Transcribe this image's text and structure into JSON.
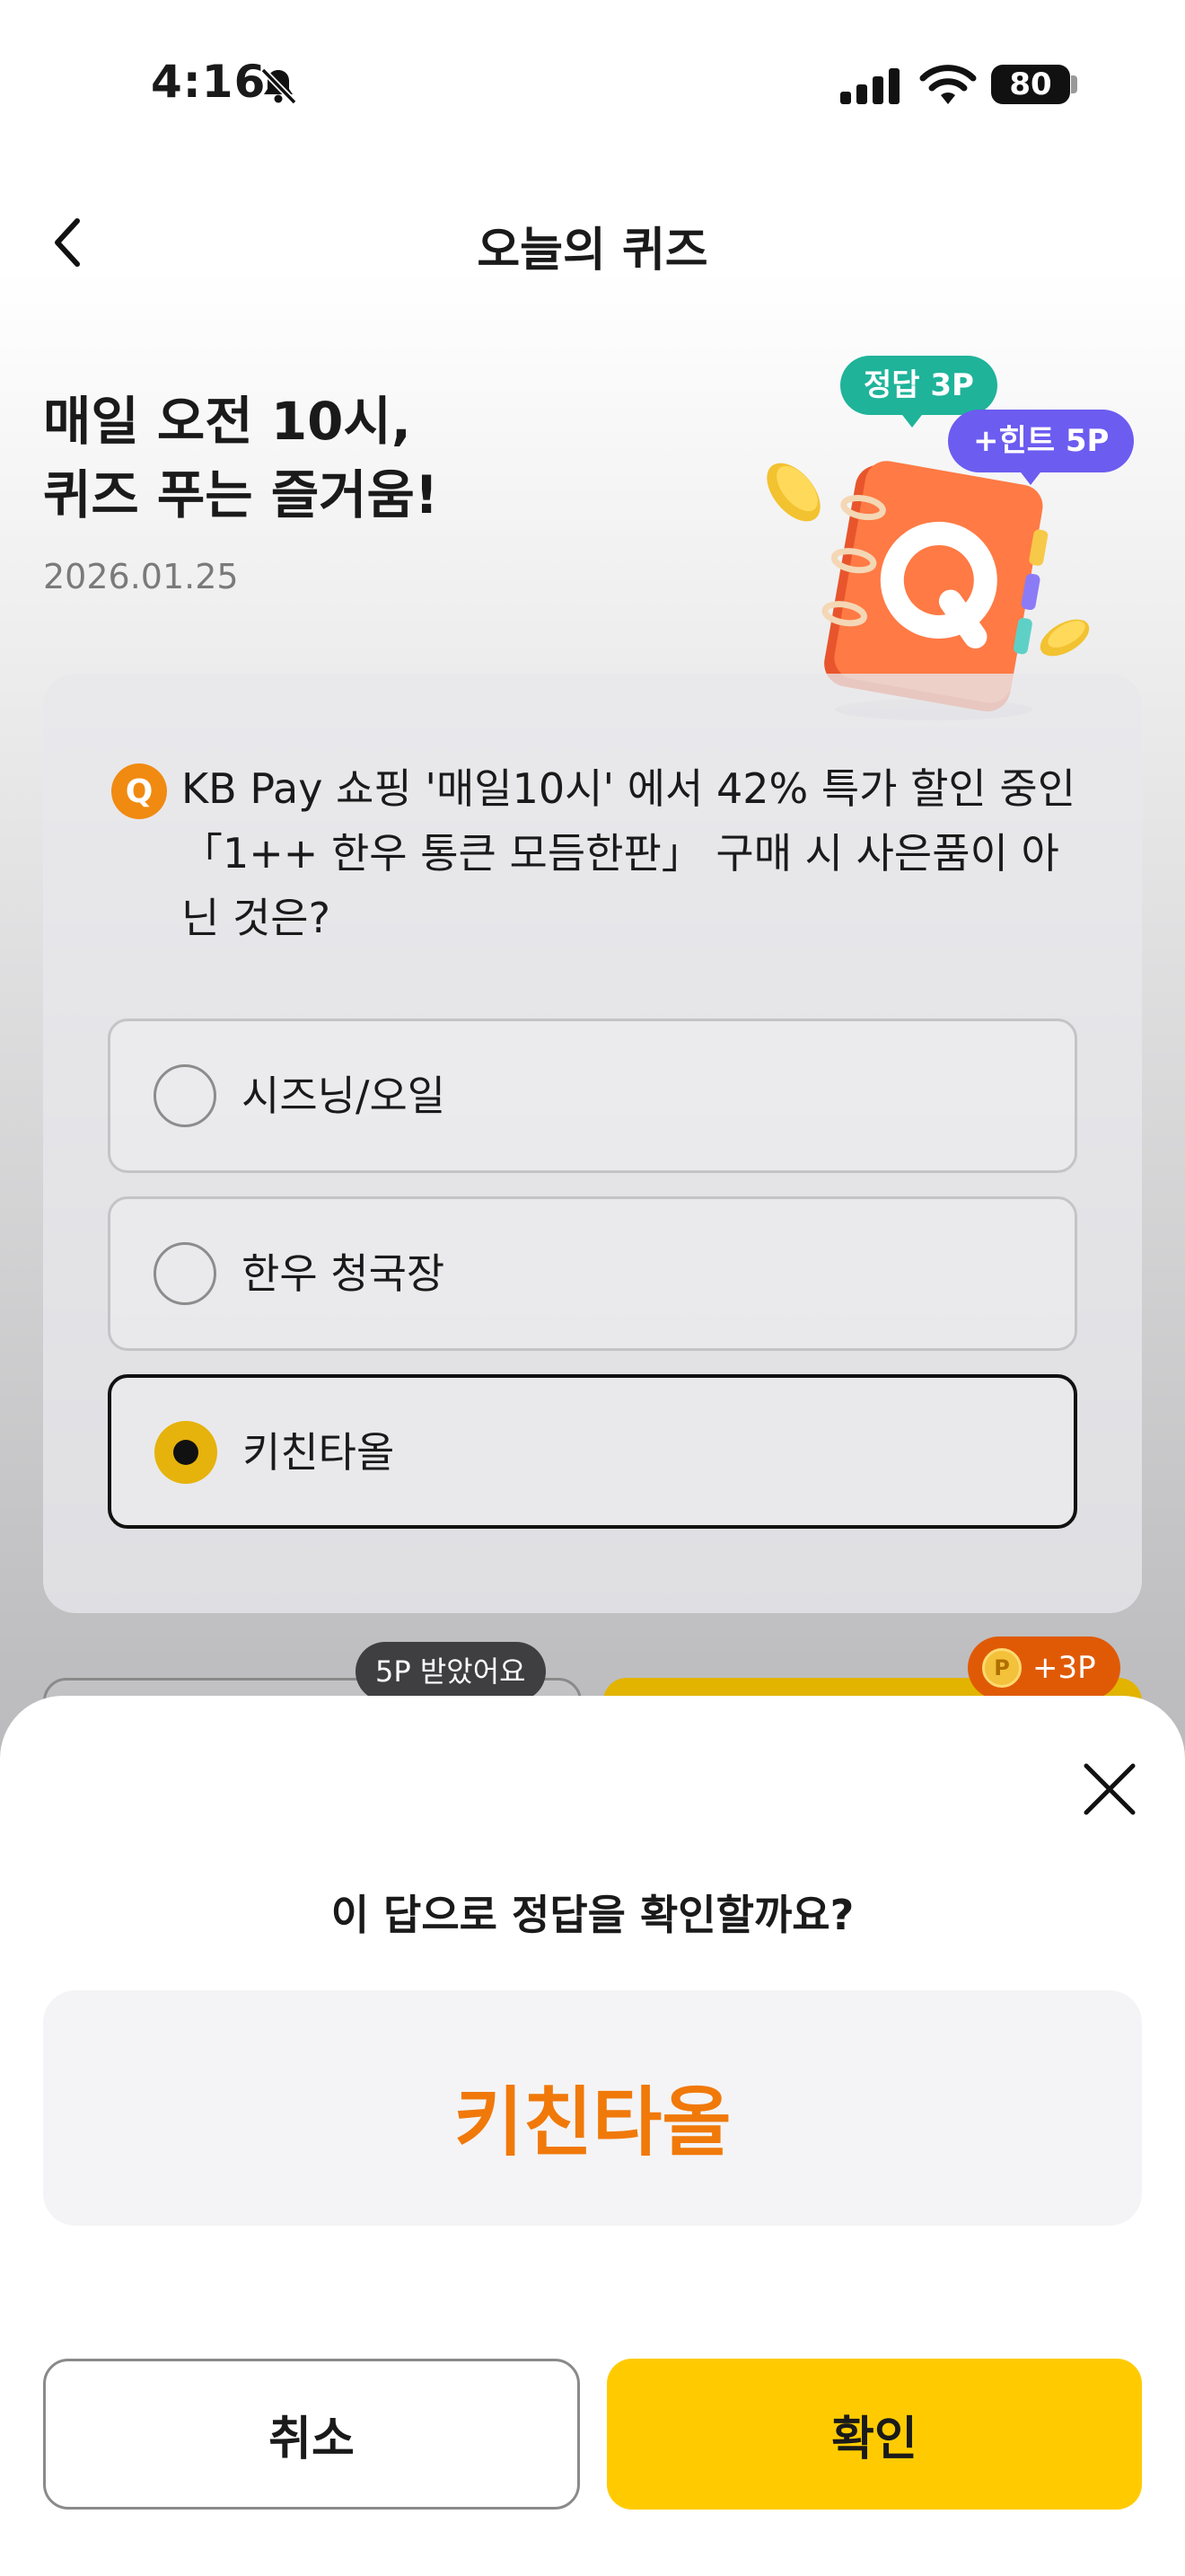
{
  "status_bar": {
    "time": "4:16",
    "battery": "80",
    "icons": [
      "bell-slash-icon",
      "cellular-signal-icon",
      "wifi-icon",
      "battery-icon"
    ]
  },
  "nav": {
    "back_icon": "chevron-left-icon",
    "title": "오늘의 퀴즈"
  },
  "header": {
    "headline": "매일 오전 10시,\n퀴즈 푸는 즐거움!",
    "date": "2026.01.25",
    "badge_answer": "정답 3P",
    "badge_hint": "+힌트 5P",
    "illustration": "quiz-notebook-illustration"
  },
  "quiz": {
    "q_mark": "Q",
    "question": "KB Pay 쇼핑 '매일10시' 에서 42% 특가 할인 중인 「1++ 한우 통큰 모듬한판」 구매 시 사은품이 아닌 것은?",
    "options": [
      {
        "label": "시즈닝/오일",
        "selected": false
      },
      {
        "label": "한우 청국장",
        "selected": false
      },
      {
        "label": "키친타올",
        "selected": true
      }
    ]
  },
  "behind_buttons": {
    "hint_bubble": "5P 받았어요",
    "points_bubble": "+3P",
    "coin_label": "P"
  },
  "sheet": {
    "close_icon": "close-icon",
    "title": "이 답으로 정답을 확인할까요?",
    "selected_answer": "키친타올",
    "cancel_label": "취소",
    "confirm_label": "확인"
  },
  "colors": {
    "accent_yellow": "#ffcb00",
    "answer_orange": "#f0790a",
    "badge_teal": "#1fb39a",
    "badge_purple": "#6c5cf0"
  }
}
